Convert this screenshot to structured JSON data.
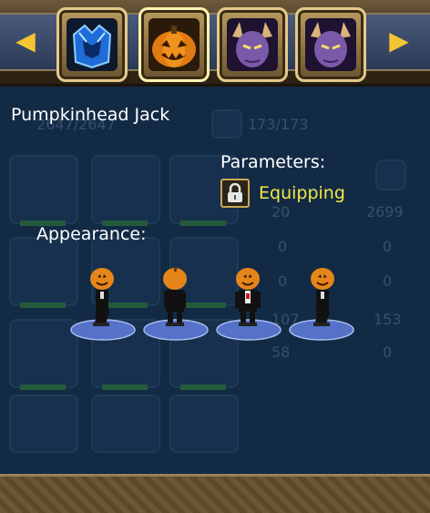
{
  "tabs": [
    {
      "name": "blue-armor-tab",
      "selected": false
    },
    {
      "name": "pumpkin-tab",
      "selected": true
    },
    {
      "name": "demon-tab-1",
      "selected": false
    },
    {
      "name": "demon-tab-2",
      "selected": false
    }
  ],
  "nav": {
    "left_icon": "triangle-left-icon",
    "right_icon": "triangle-right-icon"
  },
  "character": {
    "name": "Pumpkinhead Jack"
  },
  "parameters": {
    "label": "Parameters:",
    "status": "Equipping"
  },
  "appearance": {
    "label": "Appearance:"
  },
  "background_stats": {
    "hp": "2647/2647",
    "mp": "173/173",
    "values": [
      "20",
      "2699",
      "0",
      "0",
      "0",
      "0",
      "107",
      "153",
      "58",
      "0"
    ]
  },
  "colors": {
    "accent_yellow": "#f2e94a",
    "panel": "#132a45",
    "gold": "#e4c98c"
  }
}
